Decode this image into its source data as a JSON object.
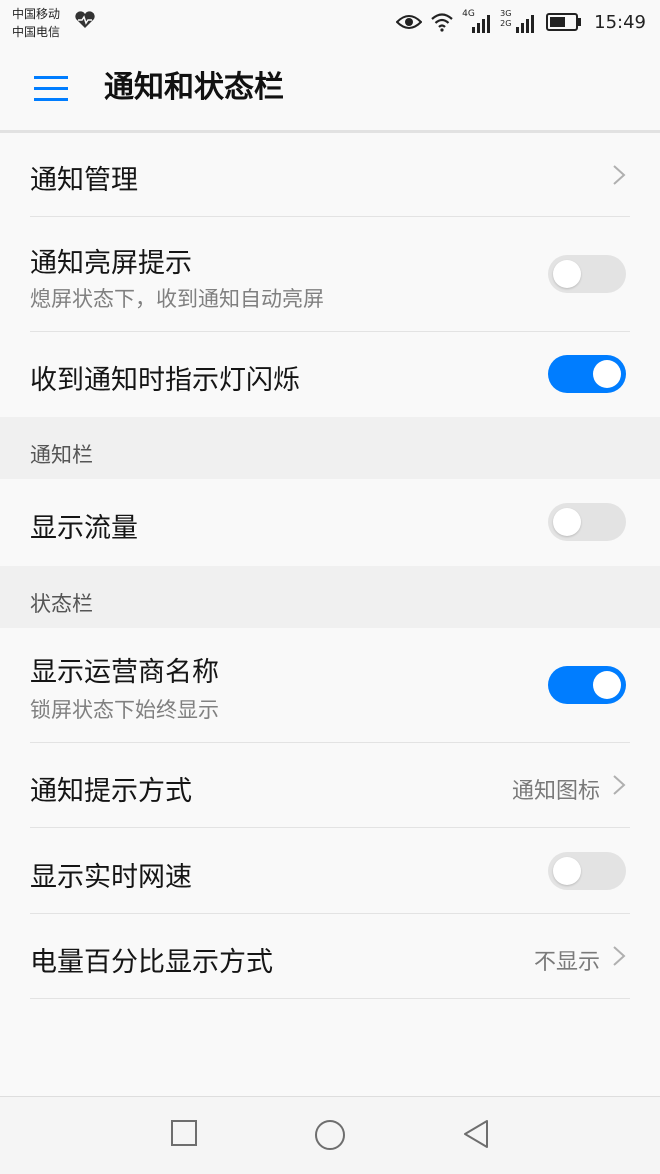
{
  "status_bar": {
    "carrier1": "中国移动",
    "carrier2": "中国电信",
    "net1": "4G",
    "net2": "3G 2G",
    "time": "15:49"
  },
  "header": {
    "title": "通知和状态栏"
  },
  "rows": {
    "notif_mgmt": {
      "label": "通知管理"
    },
    "wake_screen": {
      "label": "通知亮屏提示",
      "sub": "熄屏状态下，收到通知自动亮屏",
      "on": false
    },
    "indicator_light": {
      "label": "收到通知时指示灯闪烁",
      "on": true
    },
    "show_traffic": {
      "label": "显示流量",
      "on": false
    },
    "carrier_name": {
      "label": "显示运营商名称",
      "sub": "锁屏状态下始终显示",
      "on": true
    },
    "notif_style": {
      "label": "通知提示方式",
      "value": "通知图标"
    },
    "net_speed": {
      "label": "显示实时网速",
      "on": false
    },
    "battery_pct": {
      "label": "电量百分比显示方式",
      "value": "不显示"
    }
  },
  "sections": {
    "notification_bar": "通知栏",
    "status_bar": "状态栏"
  },
  "colors": {
    "accent": "#007dff",
    "toggle_off": "#e3e3e3",
    "section_bg": "#f0f0f0"
  },
  "icons": {
    "status": [
      "heart-icon",
      "eye-icon",
      "wifi-icon",
      "signal-icon",
      "battery-icon"
    ],
    "nav": [
      "recent-apps-icon",
      "home-icon",
      "back-icon"
    ]
  }
}
